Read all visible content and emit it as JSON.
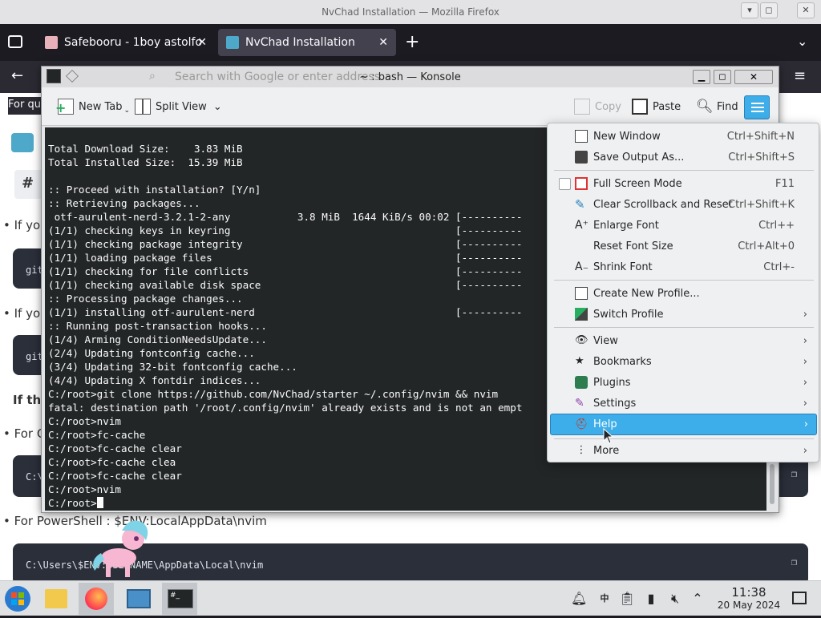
{
  "firefox": {
    "window_title": "NvChad Installation — Mozilla Firefox",
    "tabs": [
      {
        "label": "Safebooru - 1boy astolfo",
        "active": false
      },
      {
        "label": "NvChad Installation",
        "active": true
      }
    ],
    "url_placeholder": "Search with Google or enter address",
    "content": {
      "snippet_for_qu": "For qu",
      "bullet_1": "• If yo",
      "bullet_2": "• If yo",
      "if_the": "If the",
      "for_c": "• For C",
      "code_1": "git",
      "code_2": "git",
      "code_3": "C:\\",
      "for_powershell": "• For PowerShell : $ENV:LocalAppData\\nvim",
      "code_ps": "C:\\Users\\$ENV:USERNAME\\AppData\\Local\\nvim"
    }
  },
  "konsole": {
    "title": "~ : bash — Konsole",
    "toolbar": {
      "new_tab": "New Tab",
      "split_view": "Split View",
      "copy": "Copy",
      "paste": "Paste",
      "find": "Find"
    },
    "terminal_lines": [
      "Total Download Size:    3.83 MiB",
      "Total Installed Size:  15.39 MiB",
      "",
      ":: Proceed with installation? [Y/n]",
      ":: Retrieving packages...",
      " otf-aurulent-nerd-3.2.1-2-any           3.8 MiB  1644 KiB/s 00:02 [----------",
      "(1/1) checking keys in keyring                                     [----------",
      "(1/1) checking package integrity                                   [----------",
      "(1/1) loading package files                                        [----------",
      "(1/1) checking for file conflicts                                  [----------",
      "(1/1) checking available disk space                                [----------",
      ":: Processing package changes...",
      "(1/1) installing otf-aurulent-nerd                                 [----------",
      ":: Running post-transaction hooks...",
      "(1/4) Arming ConditionNeedsUpdate...",
      "(2/4) Updating fontconfig cache...",
      "(3/4) Updating 32-bit fontconfig cache...",
      "(4/4) Updating X fontdir indices...",
      "C:/root>git clone https://github.com/NvChad/starter ~/.config/nvim && nvim",
      "fatal: destination path '/root/.config/nvim' already exists and is not an empt",
      "C:/root>nvim",
      "C:/root>fc-cache",
      "C:/root>fc-cache clear",
      "C:/root>fc-cache clea",
      "C:/root>fc-cache clear",
      "C:/root>nvim"
    ],
    "prompt": "C:/root>"
  },
  "menu": {
    "items": [
      {
        "label": "New Window",
        "shortcut": "Ctrl+Shift+N"
      },
      {
        "label": "Save Output As...",
        "shortcut": "Ctrl+Shift+S"
      },
      {
        "label": "Full Screen Mode",
        "shortcut": "F11"
      },
      {
        "label": "Clear Scrollback and Reset",
        "shortcut": "Ctrl+Shift+K"
      },
      {
        "label": "Enlarge Font",
        "shortcut": "Ctrl++"
      },
      {
        "label": "Reset Font Size",
        "shortcut": "Ctrl+Alt+0"
      },
      {
        "label": "Shrink Font",
        "shortcut": "Ctrl+-"
      },
      {
        "label": "Create New Profile..."
      },
      {
        "label": "Switch Profile"
      },
      {
        "label": "View"
      },
      {
        "label": "Bookmarks"
      },
      {
        "label": "Plugins"
      },
      {
        "label": "Settings"
      },
      {
        "label": "Help"
      },
      {
        "label": "More"
      }
    ]
  },
  "taskbar": {
    "time": "11:38",
    "date": "20 May 2024"
  },
  "colors": {
    "accent": "#3daee9",
    "terminal_bg": "#232627",
    "terminal_fg": "#fcfcfc"
  }
}
